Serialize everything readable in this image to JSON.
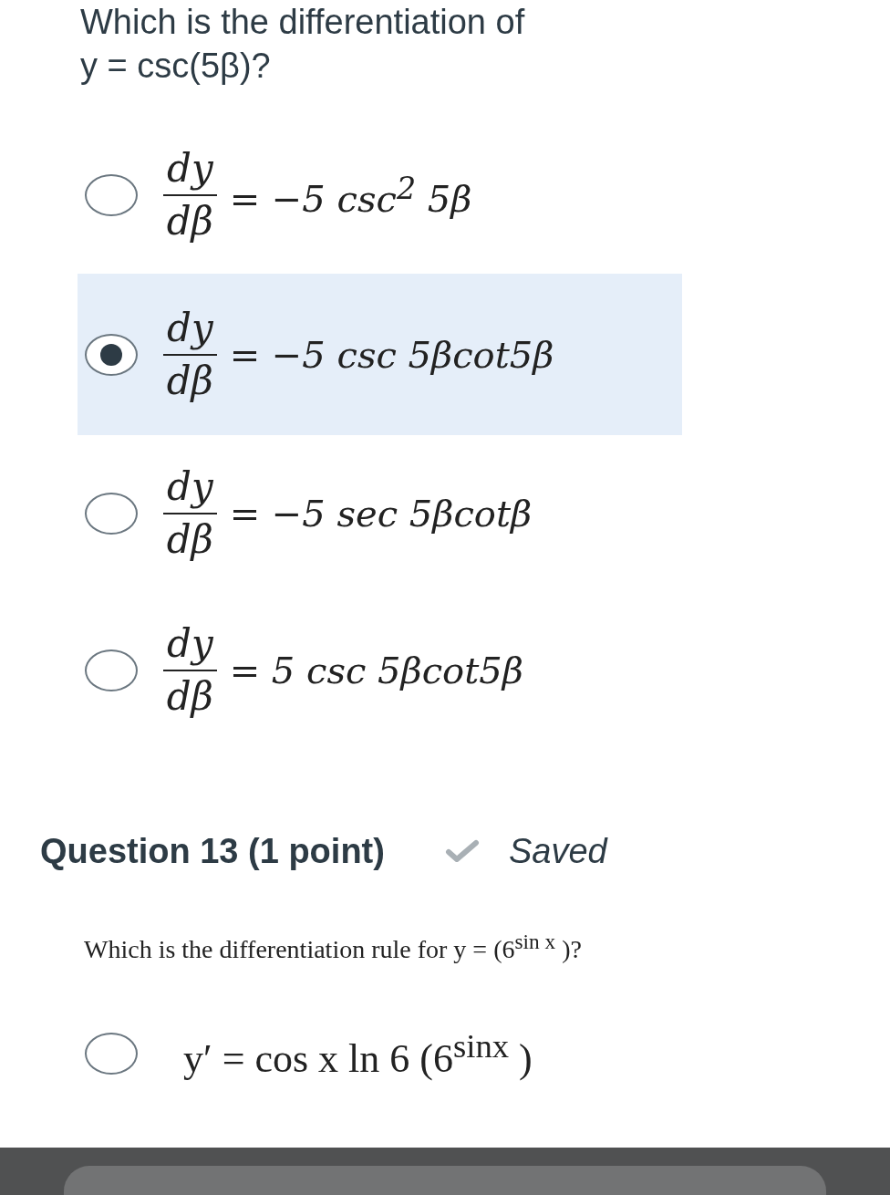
{
  "prev_question": {
    "lines": [
      "Which is the differentiation of",
      "y = csc(5β)?"
    ],
    "options": [
      {
        "kind": "fraction",
        "numerator": "dy",
        "denominator": "dβ",
        "rhs": "= −5 csc$^{2}$ 5β",
        "selected": false
      },
      {
        "kind": "fraction",
        "numerator": "dy",
        "denominator": "dβ",
        "rhs": "= −5 csc 5βcot5β",
        "selected": true
      },
      {
        "kind": "fraction",
        "numerator": "dy",
        "denominator": "dβ",
        "rhs": "= −5 sec 5βcotβ",
        "selected": false
      },
      {
        "kind": "fraction",
        "numerator": "dy",
        "denominator": "dβ",
        "rhs": "= 5 csc 5βcot5β",
        "selected": false
      }
    ]
  },
  "question": {
    "title": "Question 13 (1 point)",
    "status": "Saved",
    "saved": true,
    "prompt": "Which is the differentiation rule for y = (6$^{sin x}$ )?",
    "options": [
      {
        "kind": "inline",
        "formula": "y′ = cos x ln 6 (6$^{sinx}$ )",
        "selected": false
      }
    ]
  }
}
